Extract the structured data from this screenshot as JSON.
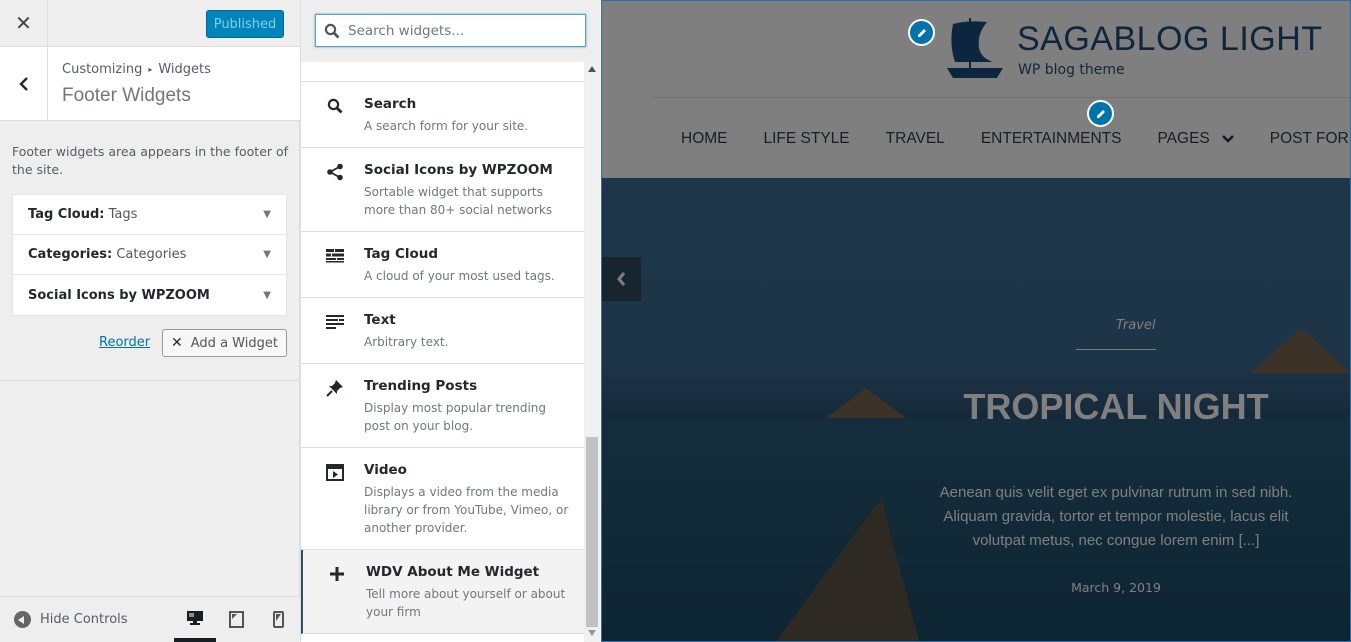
{
  "customizer": {
    "close_label": "✕",
    "publish_label": "Published",
    "breadcrumb": {
      "root": "Customizing",
      "separator": "▸",
      "parent": "Widgets"
    },
    "section_title": "Footer Widgets",
    "description": "Footer widgets area appears in the footer of the site.",
    "widgets": [
      {
        "title": "Tag Cloud:",
        "subtitle": "Tags"
      },
      {
        "title": "Categories:",
        "subtitle": "Categories"
      },
      {
        "title": "Social Icons by WPZOOM",
        "subtitle": ""
      }
    ],
    "reorder_label": "Reorder",
    "add_widget_label": "Add a Widget",
    "add_widget_icon": "✕",
    "hide_controls_label": "Hide Controls",
    "devices": [
      "desktop",
      "tablet",
      "mobile"
    ],
    "active_device": "desktop"
  },
  "available_widgets": {
    "search_placeholder": "Search widgets...",
    "search_value": "",
    "items": [
      {
        "icon": "search-icon",
        "name": "Search",
        "description": "A search form for your site."
      },
      {
        "icon": "share-icon",
        "name": "Social Icons by WPZOOM",
        "description": "Sortable widget that supports more than 80+ social networks"
      },
      {
        "icon": "tag-cloud-icon",
        "name": "Tag Cloud",
        "description": "A cloud of your most used tags."
      },
      {
        "icon": "text-icon",
        "name": "Text",
        "description": "Arbitrary text."
      },
      {
        "icon": "pin-icon",
        "name": "Trending Posts",
        "description": "Display most popular trending post on your blog."
      },
      {
        "icon": "video-icon",
        "name": "Video",
        "description": "Displays a video from the media library or from YouTube, Vimeo, or another provider."
      },
      {
        "icon": "plus-icon",
        "name": "WDV About Me Widget",
        "description": "Tell more about yourself or about your firm"
      }
    ],
    "selected_index": 6
  },
  "preview": {
    "site_title": "SAGABLOG LIGHT",
    "tagline": "WP blog theme",
    "nav": [
      "HOME",
      "LIFE STYLE",
      "TRAVEL",
      "ENTERTAINMENTS",
      "PAGES",
      "POST FORMATS"
    ],
    "nav_dropdown_index": 4,
    "slide": {
      "category": "Travel",
      "title": "TROPICAL NIGHT",
      "excerpt": "Aenean quis velit eget ex pulvinar rutrum in sed nibh. Aliquam gravida, tortor et tempor molestie, lacus elit volutpat metus, nec congue lorem enim [...]",
      "date": "March 9, 2019"
    },
    "colors": {
      "accent": "#0073aa",
      "title": "#1e4a7a",
      "publish": "#0085ba"
    }
  }
}
